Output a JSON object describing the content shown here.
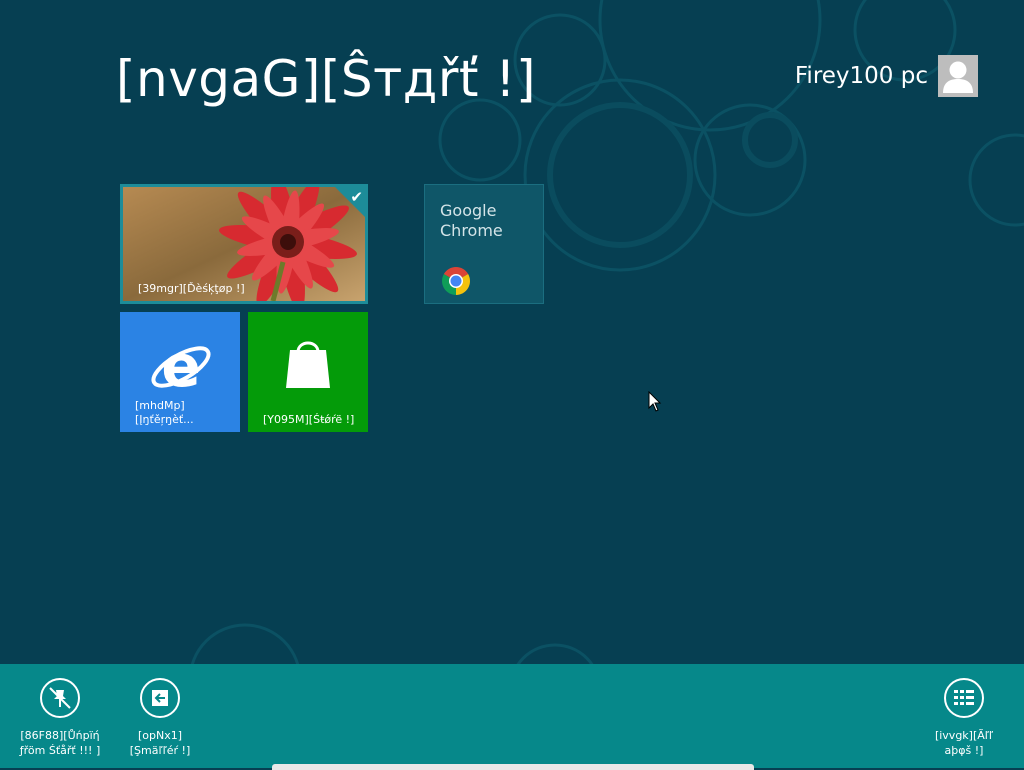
{
  "start": {
    "title": "[nvgaG][Ŝтдřť !]"
  },
  "user": {
    "name": "Firey100 pc"
  },
  "tiles": {
    "desktop": {
      "label": "[39mgr][Ďèśķţøp !]"
    },
    "chrome": {
      "name": "Google\nChrome"
    },
    "ie": {
      "label_line1": "[mhdMp]",
      "label_line2": "[Įŋťěŗŋèť..."
    },
    "store": {
      "label": "[Y095M][Śŧǿŕë !]"
    }
  },
  "app_bar": {
    "unpin_label": "[86F88][Ůńpïή\nƒřöm Śťåřť !!! ]",
    "smaller_label": "[opNx1]\n[Şmäľľéŕ !]",
    "all_apps_label": "[ivvgk][Ãľľ\naþφš !]"
  },
  "colors": {
    "background": "#063f52",
    "app_bar": "#06888a",
    "ie_tile": "#2b83e4",
    "store_tile": "#049b09",
    "chrome_tile": "#0f5668",
    "selection": "#1d8c99"
  }
}
